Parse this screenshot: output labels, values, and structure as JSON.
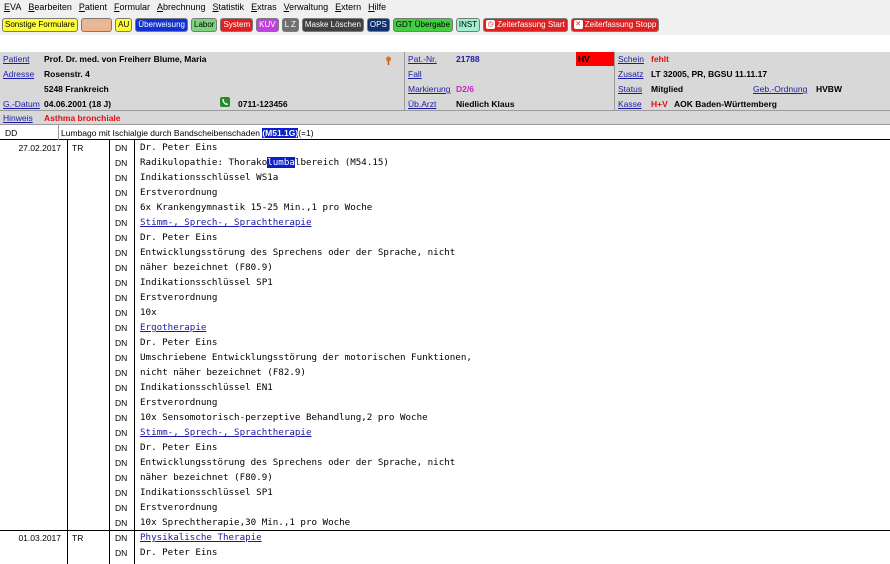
{
  "menu": [
    "EVA",
    "Bearbeiten",
    "Patient",
    "Formular",
    "Abrechnung",
    "Statistik",
    "Extras",
    "Verwaltung",
    "Extern",
    "Hilfe"
  ],
  "toolbar": [
    {
      "label": "Sonstige Formulare",
      "bg": "#ffff33",
      "fg": "#000000",
      "icon": "none"
    },
    {
      "label": "Rezept",
      "bg": "#f4b183",
      "fg": "#c8c8c8",
      "icon": "none"
    },
    {
      "label": "AU",
      "bg": "#ffff33",
      "fg": "#000000",
      "icon": "none"
    },
    {
      "label": "Überweisung",
      "bg": "#1030d0",
      "fg": "#ffffff",
      "icon": "none"
    },
    {
      "label": "Labor",
      "bg": "#7fd37f",
      "fg": "#000000",
      "icon": "none"
    },
    {
      "label": "System",
      "bg": "#e02020",
      "fg": "#ffffff",
      "icon": "none"
    },
    {
      "label": "KUV",
      "bg": "#c040e0",
      "fg": "#ffffff",
      "icon": "none"
    },
    {
      "label": "L Z",
      "bg": "#707070",
      "fg": "#ffffff",
      "icon": "none"
    },
    {
      "label": "Maske Löschen",
      "bg": "#404040",
      "fg": "#ffffff",
      "icon": "none"
    },
    {
      "label": "OPS",
      "bg": "#103070",
      "fg": "#ffffff",
      "icon": "none"
    },
    {
      "label": "GDT Übergabe",
      "bg": "#40d040",
      "fg": "#000000",
      "icon": "none"
    },
    {
      "label": "INST",
      "bg": "#a0f0d0",
      "fg": "#000000",
      "icon": "none"
    },
    {
      "label": "Zeiterfassung Start",
      "bg": "#e02020",
      "fg": "#ffffff",
      "icon": "clock-icon"
    },
    {
      "label": "Zeiterfassung Stopp",
      "bg": "#e02020",
      "fg": "#ffffff",
      "icon": "close-icon"
    }
  ],
  "patient": {
    "patient_label": "Patient",
    "patient_value": "Prof. Dr. med. von Freiherr Blume, Maria",
    "adresse_label": "Adresse",
    "street": "Rosenstr. 4",
    "city": "5248 Frankreich",
    "gdatum_label": "G.-Datum",
    "gdatum_value": "04.06.2001 (18 J)",
    "phone": "0711-123456",
    "patnr_label": "Pat.-Nr.",
    "patnr_value": "21788",
    "hv_badge": "HV",
    "fall_label": "Fall",
    "markierung_label": "Markierung",
    "markierung_value": "D2/6",
    "ubarzt_label": "Üb.Arzt",
    "ubarzt_value": "Niedlich Klaus",
    "schein_label": "Schein",
    "schein_value": "fehlt",
    "zusatz_label": "Zusatz",
    "zusatz_value": "LT 32005, PR, BGSU 11.11.17",
    "status_label": "Status",
    "status_value": "Mitglied",
    "geb_label": "Geb.-Ordnung",
    "geb_value": "HVBW",
    "kasse_label": "Kasse",
    "kasse_value_prefix": "H+V",
    "kasse_value": "AOK Baden-Württemberg"
  },
  "hinweis": {
    "label": "Hinweis",
    "value": "Asthma bronchiale"
  },
  "dd": {
    "label": "DD",
    "text": "Lumbago mit Ischialgie durch Bandscheibenschaden",
    "code": "(M51.1G)",
    "suffix": "(=1)"
  },
  "entries": [
    {
      "date": "27.02.2017",
      "typ": "TR",
      "code": "DN",
      "text": "Dr. Peter Eins"
    },
    {
      "date": "",
      "typ": "",
      "code": "DN",
      "text": "Radikulopathie: Thorako",
      "hl": "lumba",
      "rest": "lbereich (M54.15)"
    },
    {
      "date": "",
      "typ": "",
      "code": "DN",
      "text": "Indikationsschlüssel WS1a"
    },
    {
      "date": "",
      "typ": "",
      "code": "DN",
      "text": "Erstverordnung"
    },
    {
      "date": "",
      "typ": "",
      "code": "DN",
      "text": "6x Krankengymnastik 15-25 Min.,1 pro Woche"
    },
    {
      "date": "",
      "typ": "",
      "code": "DN",
      "text": "Stimm-, Sprech-, Sprachtherapie",
      "link": true
    },
    {
      "date": "",
      "typ": "",
      "code": "DN",
      "text": "Dr. Peter Eins"
    },
    {
      "date": "",
      "typ": "",
      "code": "DN",
      "text": "Entwicklungsstörung des Sprechens oder der Sprache, nicht"
    },
    {
      "date": "",
      "typ": "",
      "code": "DN",
      "text": "näher bezeichnet (F80.9)"
    },
    {
      "date": "",
      "typ": "",
      "code": "DN",
      "text": "Indikationsschlüssel SP1"
    },
    {
      "date": "",
      "typ": "",
      "code": "DN",
      "text": "Erstverordnung"
    },
    {
      "date": "",
      "typ": "",
      "code": "DN",
      "text": "10x"
    },
    {
      "date": "",
      "typ": "",
      "code": "DN",
      "text": "Ergotherapie",
      "link": true
    },
    {
      "date": "",
      "typ": "",
      "code": "DN",
      "text": "Dr. Peter Eins"
    },
    {
      "date": "",
      "typ": "",
      "code": "DN",
      "text": "Umschriebene Entwicklungsstörung der motorischen Funktionen,"
    },
    {
      "date": "",
      "typ": "",
      "code": "DN",
      "text": "nicht näher bezeichnet (F82.9)"
    },
    {
      "date": "",
      "typ": "",
      "code": "DN",
      "text": "Indikationsschlüssel EN1"
    },
    {
      "date": "",
      "typ": "",
      "code": "DN",
      "text": "Erstverordnung"
    },
    {
      "date": "",
      "typ": "",
      "code": "DN",
      "text": "10x Sensomotorisch-perzeptive Behandlung,2 pro Woche"
    },
    {
      "date": "",
      "typ": "",
      "code": "DN",
      "text": "Stimm-, Sprech-, Sprachtherapie",
      "link": true
    },
    {
      "date": "",
      "typ": "",
      "code": "DN",
      "text": "Dr. Peter Eins"
    },
    {
      "date": "",
      "typ": "",
      "code": "DN",
      "text": "Entwicklungsstörung des Sprechens oder der Sprache, nicht"
    },
    {
      "date": "",
      "typ": "",
      "code": "DN",
      "text": "näher bezeichnet (F80.9)"
    },
    {
      "date": "",
      "typ": "",
      "code": "DN",
      "text": "Indikationsschlüssel SP1"
    },
    {
      "date": "",
      "typ": "",
      "code": "DN",
      "text": "Erstverordnung"
    },
    {
      "date": "",
      "typ": "",
      "code": "DN",
      "text": "10x Sprechtherapie,30 Min.,1 pro Woche"
    },
    {
      "date": "01.03.2017",
      "typ": "TR",
      "code": "DN",
      "text": "Physikalische Therapie",
      "link": true
    },
    {
      "date": "",
      "typ": "",
      "code": "DN",
      "text": "Dr. Peter Eins"
    }
  ]
}
